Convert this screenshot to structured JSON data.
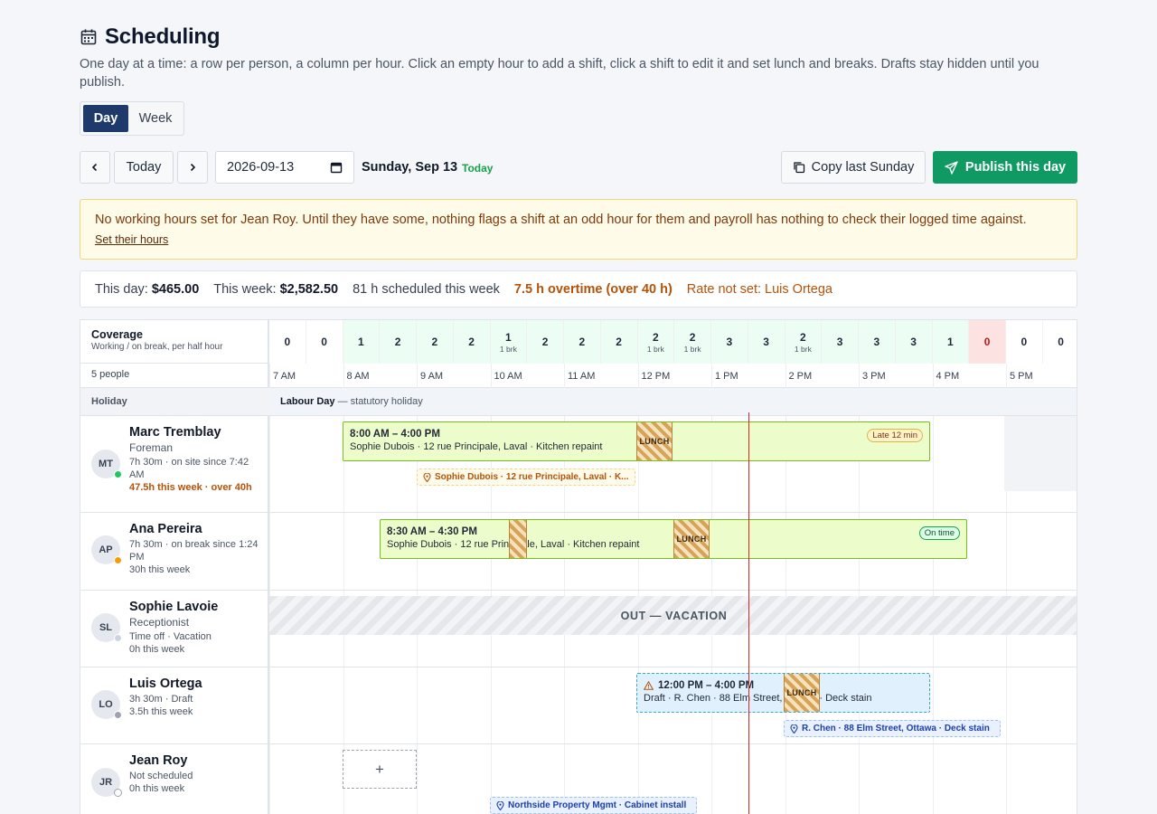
{
  "header": {
    "title": "Scheduling",
    "subtitle": "One day at a time: a row per person, a column per hour. Click an empty hour to add a shift, click a shift to edit it and set lunch and breaks. Drafts stay hidden until you publish."
  },
  "view_toggle": {
    "day": "Day",
    "week": "Week",
    "selected": "Day"
  },
  "toolbar": {
    "today_label": "Today",
    "date_value": "2026-09-13",
    "date_label": "Sunday, Sep 13",
    "today_tag": "Today",
    "copy_label": "Copy last Sunday",
    "publish_label": "Publish this day"
  },
  "warning": {
    "text": "No working hours set for Jean Roy. Until they have some, nothing flags a shift at an odd hour for them and payroll has nothing to check their logged time against.",
    "link": "Set their hours"
  },
  "summary": {
    "day_label": "This day:",
    "day_value": "$465.00",
    "week_label": "This week:",
    "week_value": "$2,582.50",
    "scheduled": "81 h scheduled this week",
    "overtime": "7.5 h overtime (over 40 h)",
    "rate": "Rate not set: Luis Ortega"
  },
  "coverage": {
    "title": "Coverage",
    "subtitle": "Working / on break, per half hour",
    "people_count": "5 people",
    "slots": [
      {
        "n": "0",
        "brk": ""
      },
      {
        "n": "0",
        "brk": ""
      },
      {
        "n": "1",
        "brk": ""
      },
      {
        "n": "2",
        "brk": ""
      },
      {
        "n": "2",
        "brk": ""
      },
      {
        "n": "2",
        "brk": ""
      },
      {
        "n": "1",
        "brk": "1 brk"
      },
      {
        "n": "2",
        "brk": ""
      },
      {
        "n": "2",
        "brk": ""
      },
      {
        "n": "2",
        "brk": ""
      },
      {
        "n": "2",
        "brk": "1 brk"
      },
      {
        "n": "2",
        "brk": "1 brk"
      },
      {
        "n": "3",
        "brk": ""
      },
      {
        "n": "3",
        "brk": ""
      },
      {
        "n": "2",
        "brk": "1 brk"
      },
      {
        "n": "3",
        "brk": ""
      },
      {
        "n": "3",
        "brk": ""
      },
      {
        "n": "3",
        "brk": ""
      },
      {
        "n": "1",
        "brk": ""
      },
      {
        "n": "0",
        "brk": ""
      },
      {
        "n": "0",
        "brk": ""
      },
      {
        "n": "0",
        "brk": ""
      }
    ],
    "colors": {
      "zero": "#ffffff",
      "covered": "#ecfdf3",
      "understaffed": "#fde2e2"
    }
  },
  "hours": [
    "7 AM",
    "8 AM",
    "9 AM",
    "10 AM",
    "11 AM",
    "12 PM",
    "1 PM",
    "2 PM",
    "3 PM",
    "4 PM",
    "5 PM"
  ],
  "holiday": {
    "label": "Holiday",
    "name": "Labour Day",
    "note": "— statutory holiday"
  },
  "people": [
    {
      "initials": "MT",
      "name": "Marc Tremblay",
      "role": "Foreman",
      "status": "7h 30m · on site since 7:42 AM",
      "week": "47.5h this week · over 40h",
      "status_color": "#22c55e"
    },
    {
      "initials": "AP",
      "name": "Ana Pereira",
      "role": "",
      "status": "7h 30m · on break since 1:24 PM",
      "week": "30h this week",
      "status_color": "#f59e0b"
    },
    {
      "initials": "SL",
      "name": "Sophie Lavoie",
      "role": "Receptionist",
      "status": "Time off · Vacation",
      "week": "0h this week",
      "status_color": "#cbd5e1"
    },
    {
      "initials": "LO",
      "name": "Luis Ortega",
      "role": "",
      "status": "3h 30m · Draft",
      "week": "3.5h this week",
      "status_color": "#9ca3af"
    },
    {
      "initials": "JR",
      "name": "Jean Roy",
      "role": "",
      "status": "Not scheduled",
      "week": "0h this week",
      "status_color": "#ffffff"
    }
  ],
  "shifts": {
    "marc": {
      "time": "8:00 AM – 4:00 PM",
      "detail": "Sophie Dubois · 12 rue Principale, Laval · Kitchen repaint",
      "lunch": "LUNCH",
      "badge": "Late 12 min",
      "location": "Sophie Dubois · 12 rue Principale, Laval · K..."
    },
    "ana": {
      "time": "8:30 AM – 4:30 PM",
      "detail": "Sophie Dubois · 12 rue Principale, Laval · Kitchen repaint",
      "lunch": "LUNCH",
      "badge": "On time"
    },
    "sophie": {
      "label": "OUT — VACATION"
    },
    "luis": {
      "time": "12:00 PM – 4:00 PM",
      "detail": "Draft · R. Chen · 88 Elm Street, Ottawa · Deck stain",
      "lunch": "LUNCH",
      "location": "R. Chen · 88 Elm Street, Ottawa · Deck stain"
    },
    "jean": {
      "add": "+",
      "location": "Northside Property Mgmt · Cabinet install"
    }
  }
}
